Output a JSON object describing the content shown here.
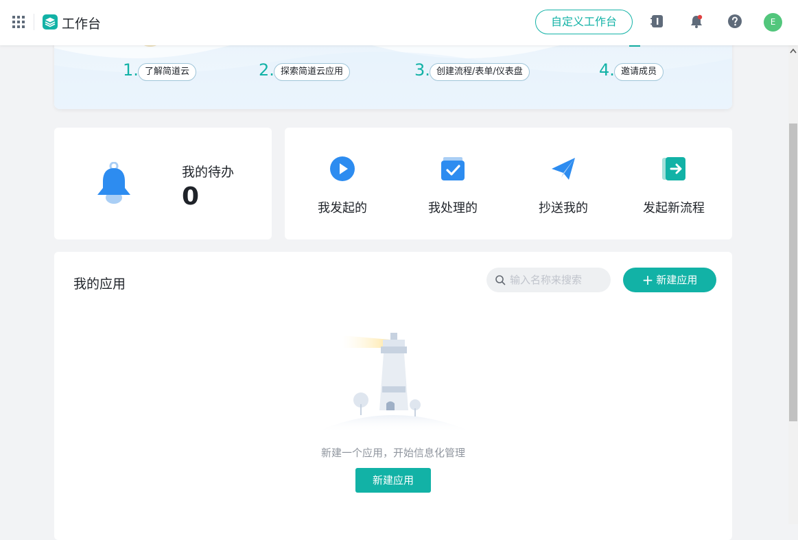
{
  "header": {
    "title": "工作台",
    "custom_button": "自定义工作台",
    "avatar_letter": "E",
    "icons": [
      "apps-grid-icon",
      "workbench-logo-icon",
      "notebook-icon",
      "bell-icon",
      "help-icon"
    ]
  },
  "banner": {
    "steps": [
      {
        "num": "1.",
        "label": "了解简道云"
      },
      {
        "num": "2.",
        "label": "探索简道云应用"
      },
      {
        "num": "3.",
        "label": "创建流程/表单/仪表盘"
      },
      {
        "num": "4.",
        "label": "邀请成员"
      }
    ]
  },
  "todo": {
    "label": "我的待办",
    "count": "0"
  },
  "shortcuts": [
    {
      "label": "我发起的",
      "icon": "play-circle-icon"
    },
    {
      "label": "我处理的",
      "icon": "check-box-icon"
    },
    {
      "label": "抄送我的",
      "icon": "paper-plane-icon"
    },
    {
      "label": "发起新流程",
      "icon": "flow-start-icon"
    }
  ],
  "apps": {
    "title": "我的应用",
    "search_placeholder": "输入名称来搜索",
    "new_button": "新建应用",
    "empty_text": "新建一个应用，开始信息化管理",
    "empty_button": "新建应用"
  },
  "colors": {
    "accent": "#12b2a6",
    "blue": "#2d8cf0",
    "avatar": "#52c67c"
  }
}
